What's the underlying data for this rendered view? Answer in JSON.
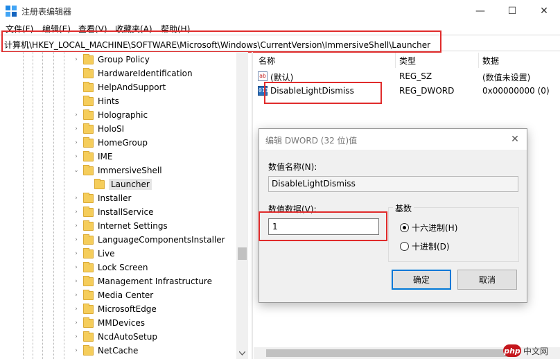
{
  "window": {
    "title": "注册表编辑器",
    "controls": {
      "minimize": "—",
      "maximize": "☐",
      "close": "✕"
    }
  },
  "menu": [
    "文件(F)",
    "编辑(E)",
    "查看(V)",
    "收藏夹(A)",
    "帮助(H)"
  ],
  "address": "计算机\\HKEY_LOCAL_MACHINE\\SOFTWARE\\Microsoft\\Windows\\CurrentVersion\\ImmersiveShell\\Launcher",
  "tree": {
    "items": [
      {
        "label": "Group Policy",
        "expander": "›"
      },
      {
        "label": "HardwareIdentification",
        "expander": ""
      },
      {
        "label": "HelpAndSupport",
        "expander": ""
      },
      {
        "label": "Hints",
        "expander": ""
      },
      {
        "label": "Holographic",
        "expander": "›"
      },
      {
        "label": "HoloSI",
        "expander": "›"
      },
      {
        "label": "HomeGroup",
        "expander": "›"
      },
      {
        "label": "IME",
        "expander": "›"
      },
      {
        "label": "ImmersiveShell",
        "expander": "⌄"
      },
      {
        "label": "Launcher",
        "expander": "",
        "child": true,
        "selected": true
      },
      {
        "label": "Installer",
        "expander": "›"
      },
      {
        "label": "InstallService",
        "expander": "›"
      },
      {
        "label": "Internet Settings",
        "expander": "›"
      },
      {
        "label": "LanguageComponentsInstaller",
        "expander": "›"
      },
      {
        "label": "Live",
        "expander": "›"
      },
      {
        "label": "Lock Screen",
        "expander": "›"
      },
      {
        "label": "Management Infrastructure",
        "expander": "›"
      },
      {
        "label": "Media Center",
        "expander": "›"
      },
      {
        "label": "MicrosoftEdge",
        "expander": "›"
      },
      {
        "label": "MMDevices",
        "expander": "›"
      },
      {
        "label": "NcdAutoSetup",
        "expander": "›"
      },
      {
        "label": "NetCache",
        "expander": "›"
      }
    ]
  },
  "list": {
    "headers": {
      "name": "名称",
      "type": "类型",
      "data": "数据"
    },
    "rows": [
      {
        "icon": "ab",
        "name": "(默认)",
        "type": "REG_SZ",
        "data": "(数值未设置)"
      },
      {
        "icon": "011",
        "name": "DisableLightDismiss",
        "type": "REG_DWORD",
        "data": "0x00000000 (0)"
      }
    ]
  },
  "dialog": {
    "title": "编辑 DWORD (32 位)值",
    "close": "✕",
    "name_label": "数值名称(N):",
    "name_value": "DisableLightDismiss",
    "data_label": "数值数据(V):",
    "data_value": "1",
    "base_label": "基数",
    "radios": [
      {
        "label": "十六进制(H)",
        "checked": true
      },
      {
        "label": "十进制(D)",
        "checked": false
      }
    ],
    "ok": "确定",
    "cancel": "取消"
  },
  "watermark": {
    "logo": "php",
    "text": "中文网"
  },
  "colors": {
    "highlight": "#e02b2b",
    "folder": "#f5cd5b",
    "accent": "#0078d7"
  }
}
